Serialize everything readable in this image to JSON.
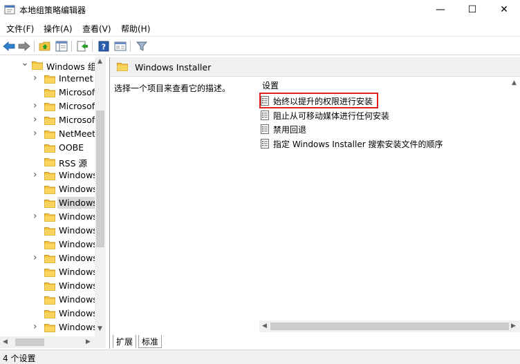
{
  "window": {
    "title": "本地组策略编辑器",
    "min_glyph": "—",
    "max_glyph": "☐",
    "close_glyph": "✕"
  },
  "menu": [
    {
      "label": "文件(F)"
    },
    {
      "label": "操作(A)"
    },
    {
      "label": "查看(V)"
    },
    {
      "label": "帮助(H)"
    }
  ],
  "toolbar": {
    "icons": [
      "back-arrow-icon",
      "forward-arrow-icon",
      "up-folder-icon",
      "show-hide-tree-icon",
      "export-list-icon",
      "help-icon",
      "properties-icon",
      "filter-icon"
    ]
  },
  "tree": {
    "items": [
      {
        "label": "Windows 组",
        "expanded": true,
        "has_children": true,
        "indent": 1
      },
      {
        "label": "Internet",
        "has_children": true,
        "indent": 2
      },
      {
        "label": "Microsoft",
        "has_children": false,
        "indent": 2
      },
      {
        "label": "Microsoft",
        "has_children": true,
        "indent": 2
      },
      {
        "label": "Microsoft",
        "has_children": true,
        "indent": 2
      },
      {
        "label": "NetMeeting",
        "has_children": true,
        "indent": 2
      },
      {
        "label": "OOBE",
        "has_children": false,
        "indent": 2
      },
      {
        "label": "RSS 源",
        "has_children": false,
        "indent": 2
      },
      {
        "label": "Windows",
        "has_children": true,
        "indent": 2
      },
      {
        "label": "Windows",
        "has_children": false,
        "indent": 2
      },
      {
        "label": "Windows",
        "has_children": false,
        "indent": 2,
        "selected": true
      },
      {
        "label": "Windows",
        "has_children": true,
        "indent": 2
      },
      {
        "label": "Windows",
        "has_children": false,
        "indent": 2
      },
      {
        "label": "Windows",
        "has_children": false,
        "indent": 2
      },
      {
        "label": "Windows",
        "has_children": true,
        "indent": 2
      },
      {
        "label": "Windows",
        "has_children": false,
        "indent": 2
      },
      {
        "label": "Windows",
        "has_children": false,
        "indent": 2
      },
      {
        "label": "Windows",
        "has_children": false,
        "indent": 2
      },
      {
        "label": "Windows",
        "has_children": false,
        "indent": 2
      },
      {
        "label": "Windows",
        "has_children": true,
        "indent": 2
      }
    ]
  },
  "details": {
    "header_title": "Windows Installer",
    "description": "选择一个项目来查看它的描述。",
    "column_header": "设置",
    "settings": [
      {
        "label": "始终以提升的权限进行安装",
        "highlighted": true
      },
      {
        "label": "阻止从可移动媒体进行任何安装"
      },
      {
        "label": "禁用回退"
      },
      {
        "label": "指定 Windows Installer 搜索安装文件的顺序"
      }
    ],
    "tabs": [
      {
        "label": "扩展",
        "active": true
      },
      {
        "label": "标准",
        "active": false
      }
    ]
  },
  "status": {
    "text": "4 个设置"
  },
  "colors": {
    "folder": "#f5c542",
    "highlight_border": "#e02020",
    "selected_bg": "#d9d9d9",
    "help_blue": "#2b5fae"
  }
}
